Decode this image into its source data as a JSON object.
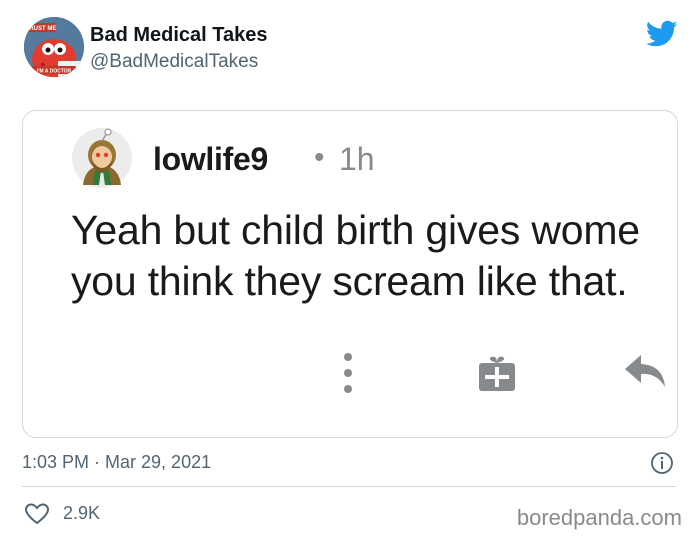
{
  "tweet": {
    "author": {
      "display_name": "Bad Medical Takes",
      "handle": "@BadMedicalTakes",
      "avatar_icon": "cartoon-doctor-avatar",
      "avatar_sign_top": "TRUST ME",
      "avatar_sign_bottom": "I'M A DOCTOR"
    },
    "brand_icon": "twitter-bird-icon",
    "brand_color": "#1d9bf0",
    "timestamp": "1:03 PM · Mar 29, 2021",
    "likes": "2.9K"
  },
  "embedded_post": {
    "username": "lowlife9",
    "separator": "•",
    "age": "1h",
    "text_line_1": "Yeah but child birth gives wome",
    "text_line_2": "you think they scream like that.",
    "actions": [
      "more-options-icon",
      "gift-icon",
      "reply-icon"
    ]
  },
  "watermark": "boredpanda.com"
}
